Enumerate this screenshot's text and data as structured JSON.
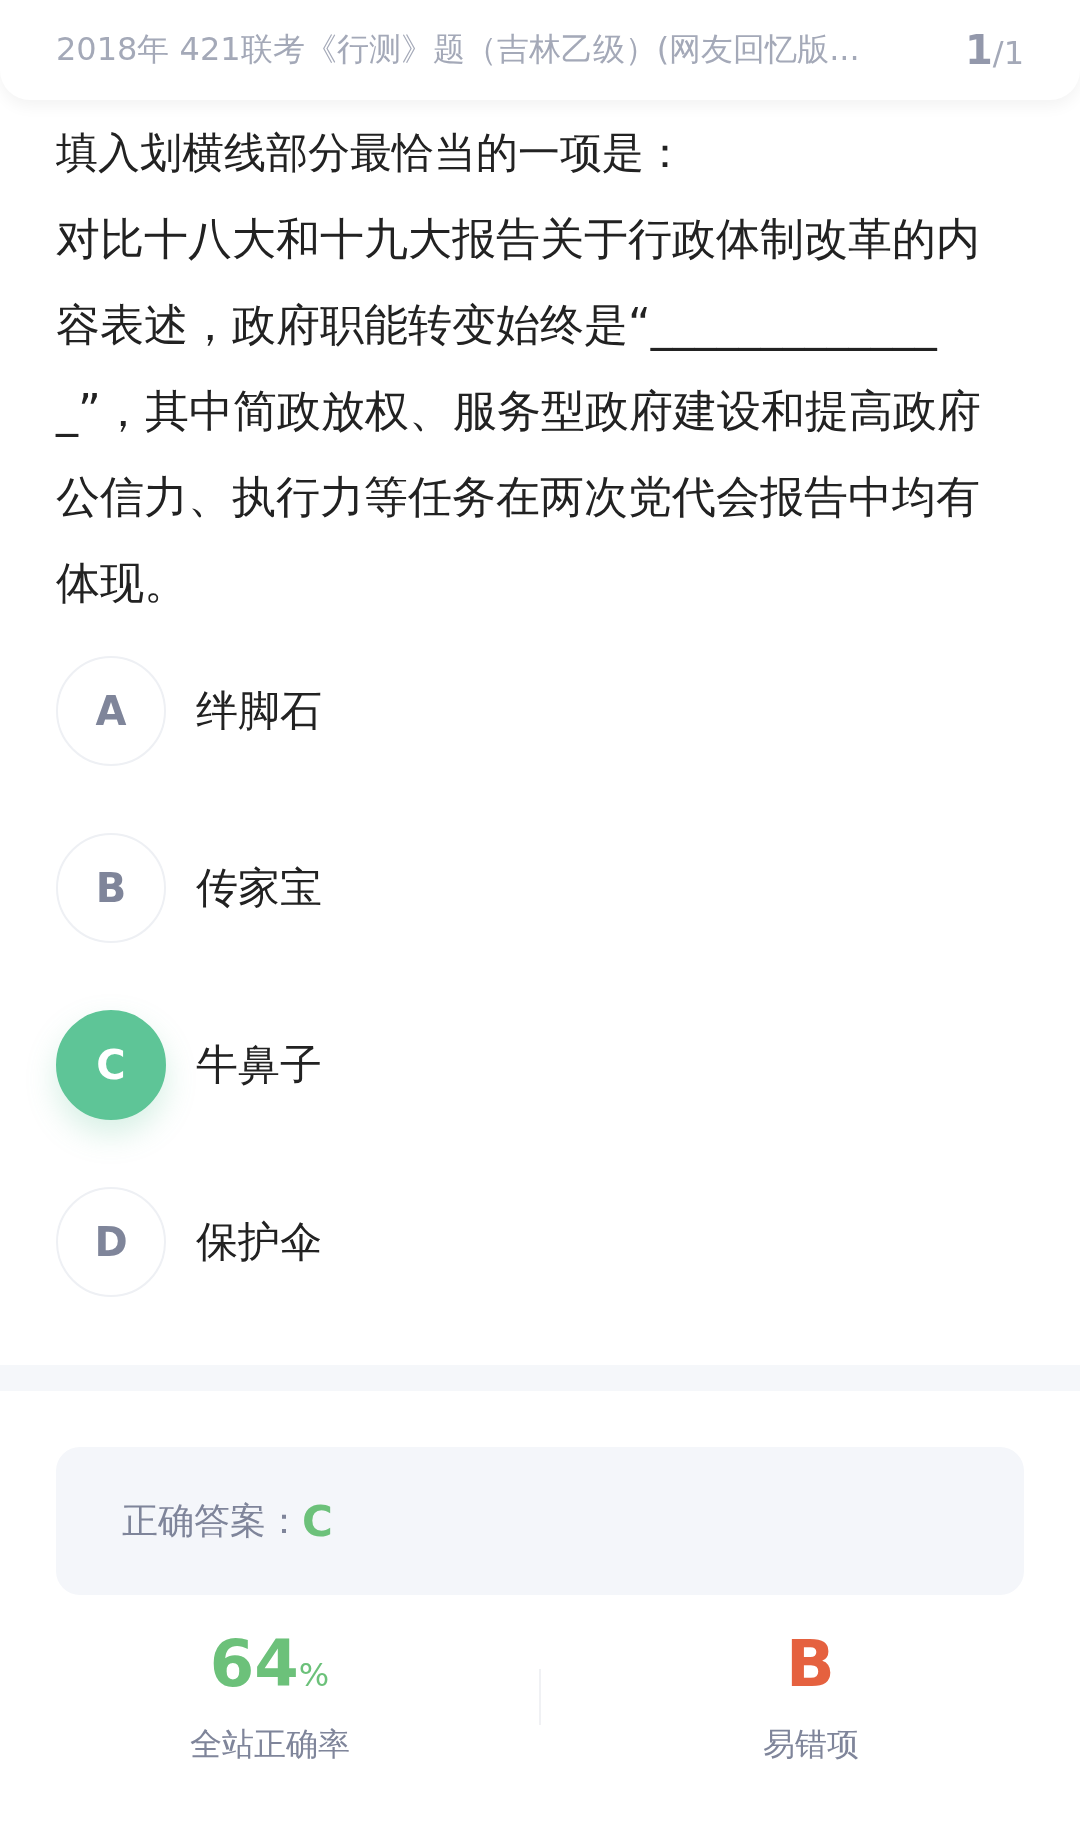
{
  "header": {
    "title": "2018年 421联考《行测》题（吉林乙级）(网友回忆版...",
    "page_current": "1",
    "page_total": "/1"
  },
  "question": {
    "prompt": "填入划横线部分最恰当的一项是：",
    "passage": "对比十八大和十九大报告关于行政体制改革的内容表述，政府职能转变始终是“______________”，其中简政放权、服务型政府建设和提高政府公信力、执行力等任务在两次党代会报告中均有体现。"
  },
  "options": [
    {
      "letter": "A",
      "text": "绊脚石",
      "selected": false
    },
    {
      "letter": "B",
      "text": "传家宝",
      "selected": false
    },
    {
      "letter": "C",
      "text": "牛鼻子",
      "selected": true
    },
    {
      "letter": "D",
      "text": "保护伞",
      "selected": false
    }
  ],
  "answer": {
    "label": "正确答案：",
    "value": "C"
  },
  "stats": {
    "rate_value": "64",
    "rate_unit": "%",
    "rate_label": "全站正确率",
    "wrong_value": "B",
    "wrong_label": "易错项"
  }
}
